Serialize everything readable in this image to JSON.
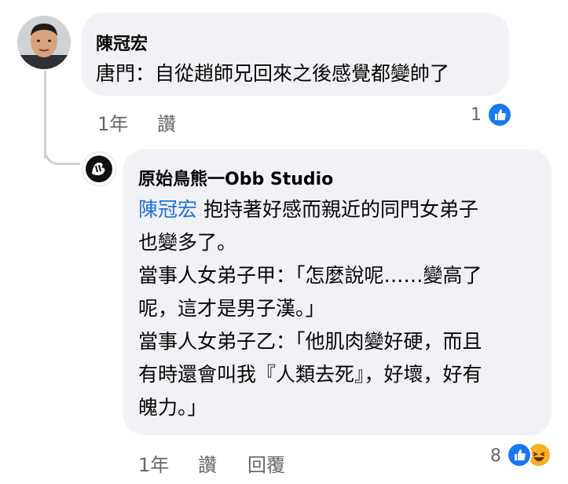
{
  "comment1": {
    "author": "陳冠宏",
    "text": "唐門：自從趙師兄回來之後感覺都變帥了",
    "time": "1年",
    "like_action": "讚",
    "reaction_count": "1",
    "reaction_icons": [
      "like-icon"
    ]
  },
  "reply1": {
    "author": "原始鳥熊一Obb Studio",
    "mention": "陳冠宏",
    "lines": [
      "抱持著好感而親近的同門女弟子",
      "也變多了。",
      "當事人女弟子甲：「怎麼說呢……變高了",
      "呢，這才是男子漢。」",
      "當事人女弟子乙：「他肌肉變好硬，而且",
      "有時還會叫我『人類去死』，好壞，好有",
      "魄力。」"
    ],
    "time": "1年",
    "like_action": "讚",
    "reply_action": "回覆",
    "reaction_count": "8",
    "reaction_icons": [
      "like-icon",
      "haha-icon"
    ]
  },
  "colors": {
    "bubble": "#f0f2f5",
    "meta": "#65676b",
    "mention": "#216fdb",
    "like": "#1877f2",
    "haha": "#f7b125"
  }
}
